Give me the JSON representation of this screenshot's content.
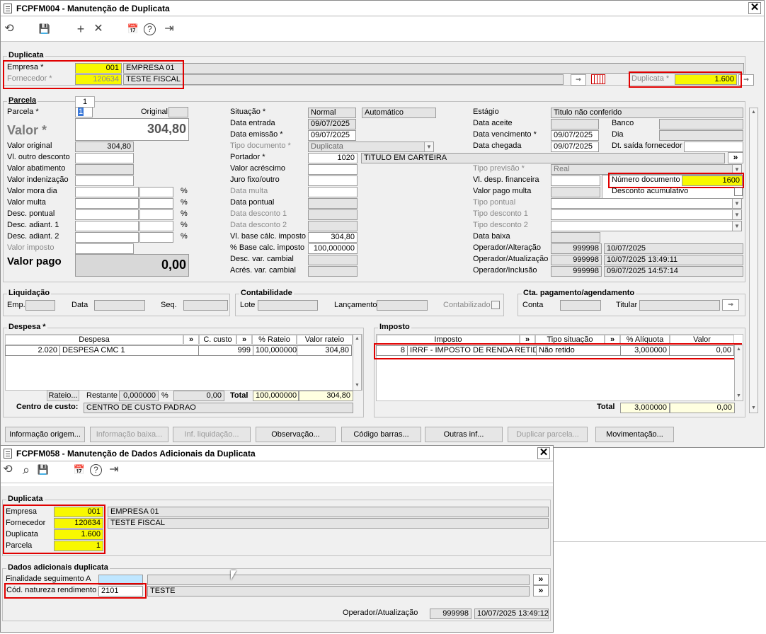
{
  "w1": {
    "title": "FCPFM004 - Manutenção de Duplicata",
    "close": "✕",
    "toolbar": {
      "undo": "⟲",
      "save": "💾",
      "add": "+",
      "cancel": "✕",
      "calendar": "📅",
      "help": "?",
      "exit": "⇥"
    },
    "dup": {
      "legend": "Duplicata",
      "empresa_label": "Empresa *",
      "empresa_code": "001",
      "empresa_name": "EMPRESA 01",
      "fornecedor_label": "Fornecedor *",
      "fornecedor_code": "120634",
      "fornecedor_name": "TESTE FISCAL",
      "duplicata_label": "Duplicata *",
      "duplicata_value": "1.600"
    },
    "parcela": {
      "legend": "Parcela",
      "tab": "1",
      "parcela_label": "Parcela *",
      "parcela_value": "1",
      "original_label": "Original",
      "valor_label": "Valor *",
      "valor_value": "304,80",
      "left": [
        {
          "label": "Valor original",
          "value": "304,80"
        },
        {
          "label": "Vl. outro desconto",
          "value": ""
        },
        {
          "label": "Valor abatimento",
          "value": ""
        },
        {
          "label": "Valor indenização",
          "value": ""
        },
        {
          "label": "Valor mora dia",
          "value": "",
          "pct": "%"
        },
        {
          "label": "Valor multa",
          "value": "",
          "pct": "%"
        },
        {
          "label": "Desc. pontual",
          "value": "",
          "pct": "%"
        },
        {
          "label": "Desc. adiant. 1",
          "value": "",
          "pct": "%"
        },
        {
          "label": "Desc. adiant. 2",
          "value": "",
          "pct": "%"
        },
        {
          "label": "Valor imposto",
          "value": ""
        }
      ],
      "valor_pago_label": "Valor pago",
      "valor_pago_value": "0,00",
      "situacao_label": "Situação *",
      "situacao_value": "Normal",
      "situacao_tipo": "Automático",
      "data_entrada_label": "Data entrada",
      "data_entrada": "09/07/2025",
      "data_emissao_label": "Data emissão *",
      "data_emissao": "09/07/2025",
      "tipo_doc_label": "Tipo documento *",
      "tipo_doc": "Duplicata",
      "portador_label": "Portador *",
      "portador_code": "1020",
      "portador_name": "TITULO EM CARTEIRA",
      "mid": [
        "Valor acréscimo",
        "Juro fixo/outro",
        "Data multa",
        "Data pontual",
        "Data desconto 1",
        "Data desconto 2"
      ],
      "vl_base_label": "Vl. base cálc. imposto",
      "vl_base": "304,80",
      "pct_base_label": "% Base calc. imposto",
      "pct_base": "100,000000",
      "desc_var_label": "Desc. var. cambial",
      "acres_var_label": "Acrés. var. cambial",
      "estagio_label": "Estágio",
      "estagio": "Titulo não conferido",
      "data_aceite_label": "Data aceite",
      "banco_label": "Banco",
      "data_venc_label": "Data vencimento *",
      "data_venc": "09/07/2025",
      "dia_label": "Dia",
      "data_chegada_label": "Data chegada",
      "data_chegada": "09/07/2025",
      "dt_saida_label": "Dt. saída fornecedor",
      "tipo_previsao_label": "Tipo previsão *",
      "tipo_previsao": "Real",
      "vl_desp_label": "Vl. desp. financeira",
      "num_doc_label": "Número documento",
      "num_doc": "1600",
      "valor_pago_multa_label": "Valor pago multa",
      "desconto_acum_label": "Desconto acumulativo",
      "tipo_pontual_label": "Tipo pontual",
      "tipo_desc1_label": "Tipo desconto 1",
      "tipo_desc2_label": "Tipo desconto 2",
      "data_baixa_label": "Data baixa",
      "op_alt_label": "Operador/Alteração",
      "op_alt_code": "999998",
      "op_alt_date": "10/07/2025",
      "op_atu_label": "Operador/Atualização",
      "op_atu_code": "999998",
      "op_atu_date": "10/07/2025 13:49:11",
      "op_inc_label": "Operador/Inclusão",
      "op_inc_code": "999998",
      "op_inc_date": "09/07/2025 14:57:14"
    },
    "liq": {
      "legend": "Liquidação",
      "emp": "Emp.",
      "data": "Data",
      "seq": "Seq."
    },
    "cont": {
      "legend": "Contabilidade",
      "lote": "Lote",
      "lanc": "Lançamento",
      "contab": "Contabilizado"
    },
    "cta": {
      "legend": "Cta. pagamento/agendamento",
      "conta": "Conta",
      "titular": "Titular"
    },
    "despesa": {
      "legend": "Despesa *",
      "headers": [
        "Despesa",
        "»",
        "C. custo",
        "»",
        "% Rateio",
        "Valor rateio"
      ],
      "row": {
        "code": "2.020",
        "name": "DESPESA CMC 1",
        "ccusto": "999",
        "rateio": "100,000000",
        "valor": "304,80"
      },
      "rateio_btn": "Rateio...",
      "restante_label": "Restante",
      "restante_pct": "0,000000",
      "pct": "%",
      "restante_val": "0,00",
      "total_label": "Total",
      "total_pct": "100,000000",
      "total_val": "304,80",
      "cc_label": "Centro de custo:",
      "cc_value": "CENTRO DE CUSTO PADRAO"
    },
    "imposto": {
      "legend": "Imposto",
      "headers": [
        "Imposto",
        "»",
        "Tipo situação",
        "»",
        "% Alíquota",
        "Valor"
      ],
      "row": {
        "code": "8",
        "name": "IRRF - IMPOSTO DE RENDA RETIDO NA FONTE",
        "tipo": "Não retido",
        "aliq": "3,000000",
        "valor": "0,00"
      },
      "total_label": "Total",
      "total_aliq": "3,000000",
      "total_val": "0,00"
    },
    "buttons": [
      "Informação origem...",
      "Informação baixa...",
      "Inf. liquidação...",
      "Observação...",
      "Código barras...",
      "Outras inf...",
      "Duplicar parcela...",
      "Movimentação..."
    ]
  },
  "w2": {
    "title": "FCPFM058 - Manutenção de Dados Adicionais da Duplicata",
    "close": "✕",
    "toolbar": {
      "undo": "⟲",
      "search": "⌕",
      "save": "💾",
      "calendar": "📅",
      "help": "?",
      "exit": "⇥"
    },
    "dup": {
      "legend": "Duplicata",
      "empresa_label": "Empresa",
      "empresa_code": "001",
      "empresa_name": "EMPRESA 01",
      "fornecedor_label": "Fornecedor",
      "fornecedor_code": "120634",
      "fornecedor_name": "TESTE FISCAL",
      "duplicata_label": "Duplicata",
      "duplicata_value": "1.600",
      "parcela_label": "Parcela",
      "parcela_value": "1"
    },
    "dados": {
      "legend": "Dados adicionais duplicata",
      "finalidade_label": "Finalidade seguimento A",
      "natureza_label": "Cód. natureza rendimento",
      "natureza_code": "2101",
      "natureza_name": "TESTE",
      "op_label": "Operador/Atualização",
      "op_code": "999998",
      "op_date": "10/07/2025 13:49:12"
    }
  }
}
